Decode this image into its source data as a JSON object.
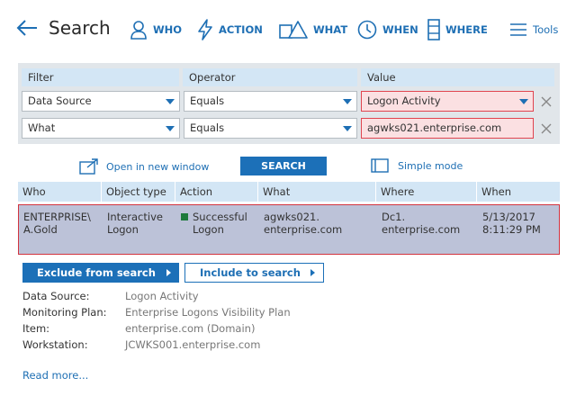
{
  "header": {
    "title": "Search",
    "nav": {
      "who": "WHO",
      "action": "ACTION",
      "what": "WHAT",
      "when": "WHEN",
      "where": "WHERE",
      "tools": "Tools"
    }
  },
  "filter": {
    "columns": {
      "filter": "Filter",
      "operator": "Operator",
      "value": "Value"
    },
    "rows": [
      {
        "filter": "Data Source",
        "operator": "Equals",
        "value": "Logon Activity"
      },
      {
        "filter": "What",
        "operator": "Equals",
        "value": "agwks021.enterprise.com"
      }
    ]
  },
  "actions": {
    "open_new_window": "Open in new window",
    "search": "SEARCH",
    "simple_mode": "Simple mode"
  },
  "results": {
    "columns": {
      "who": "Who",
      "object_type": "Object type",
      "action": "Action",
      "what": "What",
      "where": "Where",
      "when": "When"
    },
    "rows": [
      {
        "who": "ENTERPRISE\\ A.Gold",
        "object_type": "Interactive Logon",
        "action": "Successful Logon",
        "what": "agwks021. enterprise.com",
        "where": "Dc1. enterprise.com",
        "when": "5/13/2017 8:11:29 PM"
      }
    ]
  },
  "detail": {
    "exclude_label": "Exclude from search",
    "include_label": "Include to search",
    "fields": [
      {
        "label": "Data Source:",
        "value": "Logon Activity"
      },
      {
        "label": "Monitoring Plan:",
        "value": "Enterprise Logons Visibility Plan"
      },
      {
        "label": "Item:",
        "value": "enterprise.com (Domain)"
      },
      {
        "label": "Workstation:",
        "value": "JCWKS001.enterprise.com"
      }
    ],
    "read_more": "Read more..."
  },
  "colors": {
    "accent": "#1c70b8",
    "header_bg": "#d3e6f5",
    "selected_row": "#bcc2d8",
    "error_border": "#e0444f",
    "success": "#1e7a3c"
  }
}
